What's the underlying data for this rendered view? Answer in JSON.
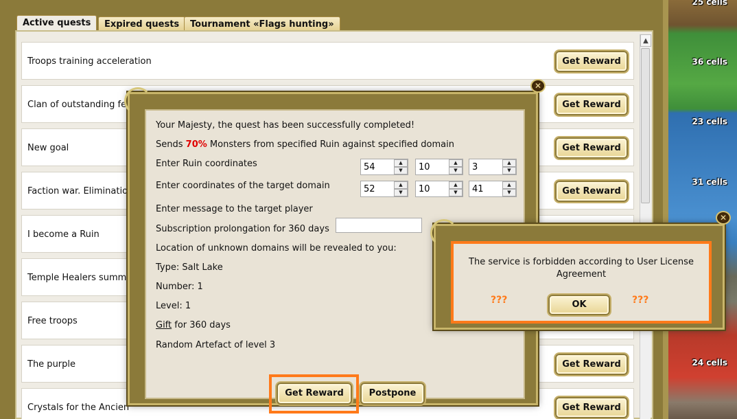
{
  "tabs": [
    {
      "label": "Active quests",
      "active": true
    },
    {
      "label": "Expired quests",
      "active": false
    },
    {
      "label": "Tournament «Flags hunting»",
      "active": false
    }
  ],
  "quests": [
    {
      "title": "Troops training acceleration",
      "button": "Get Reward"
    },
    {
      "title": "Clan of outstanding fe",
      "button": "Get Reward"
    },
    {
      "title": "New goal",
      "button": "Get Reward"
    },
    {
      "title": "Faction war. Elimination",
      "button": "Get Reward"
    },
    {
      "title": "I become a Ruin",
      "button": ""
    },
    {
      "title": "Temple Healers summo",
      "button": ""
    },
    {
      "title": "Free troops",
      "button": ""
    },
    {
      "title": "The purple",
      "button": "Get Reward"
    },
    {
      "title": "Crystals for the Ancien",
      "button": "Get Reward"
    }
  ],
  "map": {
    "cells": [
      "25 cells",
      "36 cells",
      "23 cells",
      "31 cells",
      "24 cells"
    ]
  },
  "quest_dialog": {
    "success": "Your Majesty, the quest has been successfully completed!",
    "sends_prefix": "Sends",
    "sends_percent": "70%",
    "sends_suffix": "Monsters from specified Ruin against specified domain",
    "ruin_label": "Enter Ruin coordinates",
    "ruin_coords": [
      "54",
      "10",
      "3"
    ],
    "target_label": "Enter coordinates of the target domain",
    "target_coords": [
      "52",
      "10",
      "41"
    ],
    "message_label": "Enter message to the target player",
    "message_value": "",
    "subscription": "Subscription prolongation for 360 days",
    "location": "Location of unknown domains will be revealed to you:",
    "type": "Type: Salt Lake",
    "number": "Number: 1",
    "level": "Level: 1",
    "gift_link": "Gift",
    "gift_suffix": " for 360 days",
    "artefact": "Random Artefact of level 3",
    "reward_button": "Get Reward",
    "postpone_button": "Postpone"
  },
  "license_dialog": {
    "text": "The service is forbidden according to User License Agreement",
    "qmarks_left": "???",
    "qmarks_right": "???",
    "ok_button": "OK"
  },
  "icons": {
    "close": "close-icon",
    "scroll_up": "chevron-up-icon",
    "spin_up": "arrow-up-icon",
    "spin_down": "arrow-down-icon"
  },
  "colors": {
    "highlight": "#ff7a1a",
    "percent": "#e00000",
    "frame_gold": "#8b7a3a"
  }
}
